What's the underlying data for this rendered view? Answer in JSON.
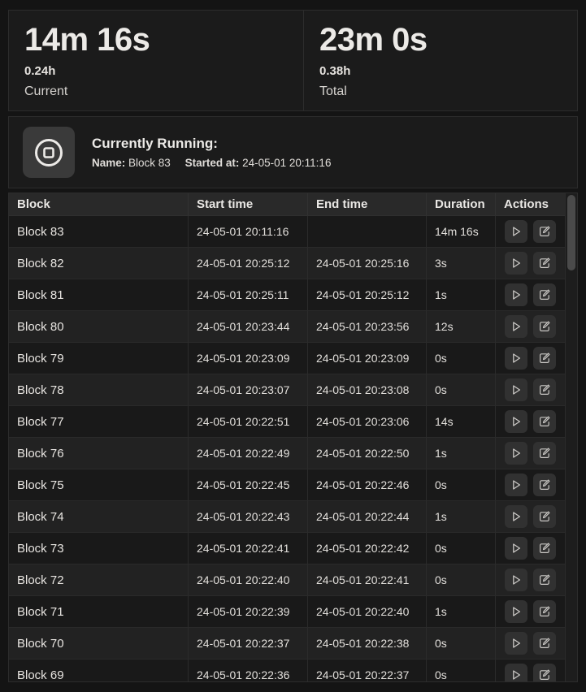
{
  "colors": {
    "background": "#141414",
    "panel": "#1b1b1b",
    "table_header": "#292929",
    "row_odd": "#191919",
    "row_even": "#222222",
    "text": "#e6e3df"
  },
  "stats": {
    "current": {
      "value": "14m 16s",
      "hours": "0.24h",
      "label": "Current"
    },
    "total": {
      "value": "23m 0s",
      "hours": "0.38h",
      "label": "Total"
    }
  },
  "running": {
    "stop_icon": "stop-circle-icon",
    "title": "Currently Running:",
    "name_label": "Name:",
    "name_value": "Block 83",
    "started_label": "Started at:",
    "started_value": "24-05-01 20:11:16"
  },
  "table": {
    "headers": [
      "Block",
      "Start time",
      "End time",
      "Duration",
      "Actions"
    ],
    "action_icons": [
      "play-icon",
      "edit-icon"
    ],
    "rows": [
      {
        "block": "Block 83",
        "start": "24-05-01 20:11:16",
        "end": "",
        "duration": "14m 16s"
      },
      {
        "block": "Block 82",
        "start": "24-05-01 20:25:12",
        "end": "24-05-01 20:25:16",
        "duration": "3s"
      },
      {
        "block": "Block 81",
        "start": "24-05-01 20:25:11",
        "end": "24-05-01 20:25:12",
        "duration": "1s"
      },
      {
        "block": "Block 80",
        "start": "24-05-01 20:23:44",
        "end": "24-05-01 20:23:56",
        "duration": "12s"
      },
      {
        "block": "Block 79",
        "start": "24-05-01 20:23:09",
        "end": "24-05-01 20:23:09",
        "duration": "0s"
      },
      {
        "block": "Block 78",
        "start": "24-05-01 20:23:07",
        "end": "24-05-01 20:23:08",
        "duration": "0s"
      },
      {
        "block": "Block 77",
        "start": "24-05-01 20:22:51",
        "end": "24-05-01 20:23:06",
        "duration": "14s"
      },
      {
        "block": "Block 76",
        "start": "24-05-01 20:22:49",
        "end": "24-05-01 20:22:50",
        "duration": "1s"
      },
      {
        "block": "Block 75",
        "start": "24-05-01 20:22:45",
        "end": "24-05-01 20:22:46",
        "duration": "0s"
      },
      {
        "block": "Block 74",
        "start": "24-05-01 20:22:43",
        "end": "24-05-01 20:22:44",
        "duration": "1s"
      },
      {
        "block": "Block 73",
        "start": "24-05-01 20:22:41",
        "end": "24-05-01 20:22:42",
        "duration": "0s"
      },
      {
        "block": "Block 72",
        "start": "24-05-01 20:22:40",
        "end": "24-05-01 20:22:41",
        "duration": "0s"
      },
      {
        "block": "Block 71",
        "start": "24-05-01 20:22:39",
        "end": "24-05-01 20:22:40",
        "duration": "1s"
      },
      {
        "block": "Block 70",
        "start": "24-05-01 20:22:37",
        "end": "24-05-01 20:22:38",
        "duration": "0s"
      },
      {
        "block": "Block 69",
        "start": "24-05-01 20:22:36",
        "end": "24-05-01 20:22:37",
        "duration": "0s"
      }
    ]
  }
}
